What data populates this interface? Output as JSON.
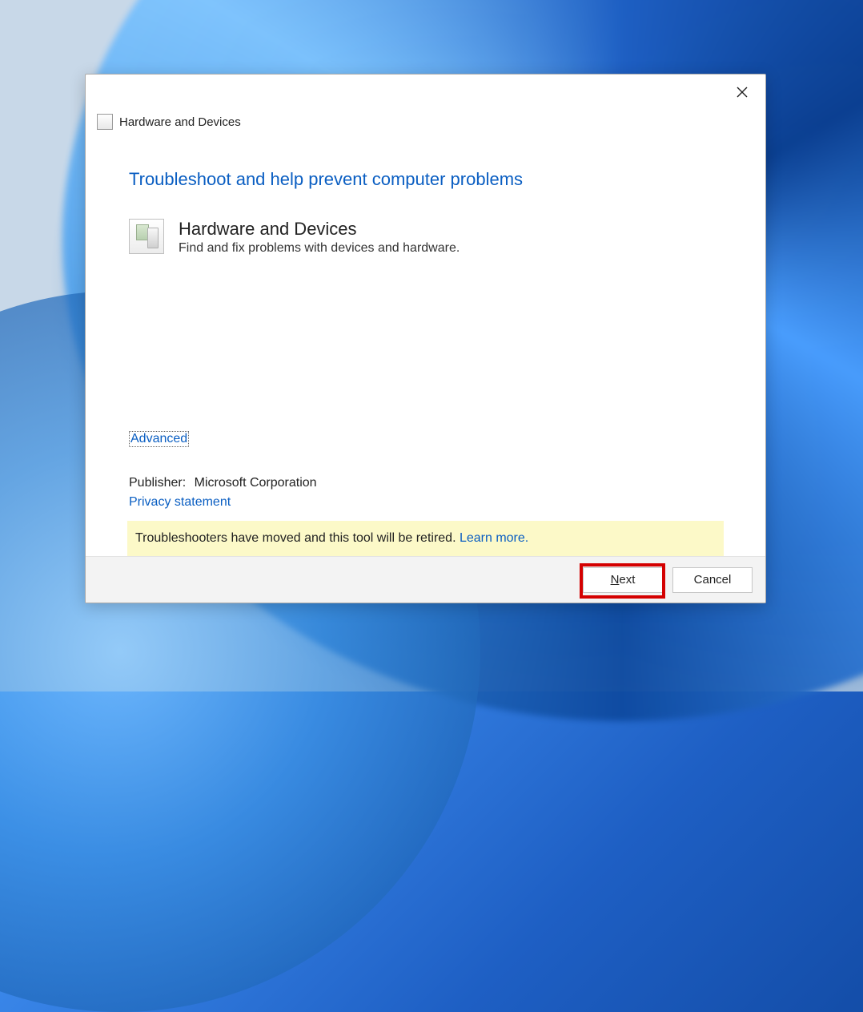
{
  "window": {
    "header_title": "Hardware and Devices"
  },
  "content": {
    "heading": "Troubleshoot and help prevent computer problems",
    "device_title": "Hardware and Devices",
    "device_subtitle": "Find and fix problems with devices and hardware.",
    "advanced_label": "Advanced",
    "publisher_label": "Publisher:",
    "publisher_value": "Microsoft Corporation",
    "privacy_label": "Privacy statement",
    "notice_text": "Troubleshooters have moved and this tool will be retired. ",
    "notice_link": "Learn more."
  },
  "buttons": {
    "next_prefix": "N",
    "next_suffix": "ext",
    "cancel": "Cancel"
  }
}
